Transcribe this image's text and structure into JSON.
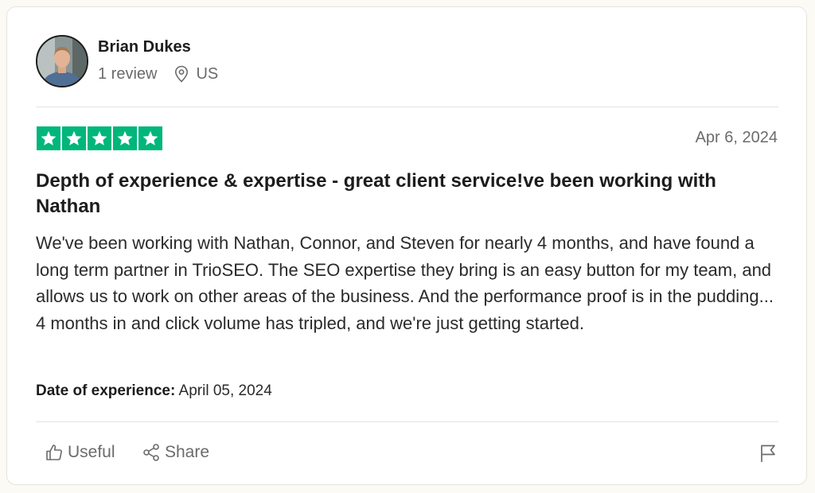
{
  "reviewer": {
    "name": "Brian Dukes",
    "review_count": "1 review",
    "country": "US",
    "avatar_icon": "user-photo"
  },
  "review": {
    "rating": 5,
    "rating_max": 5,
    "star_color": "#00b67a",
    "date": "Apr 6, 2024",
    "title": "Depth of experience & expertise - great client service!ve been working with Nathan",
    "body": "We've been working with Nathan, Connor, and Steven for nearly 4 months, and have found a long term partner in TrioSEO. The SEO expertise they bring is an easy button for my team, and allows us to work on other areas of the business. And the performance proof is in the pudding... 4 months in and click volume has tripled, and we're just getting started.",
    "experience_label": "Date of experience:",
    "experience_date": "April 05, 2024"
  },
  "actions": {
    "useful_label": "Useful",
    "useful_icon": "thumbs-up-icon",
    "share_label": "Share",
    "share_icon": "share-icon",
    "report_icon": "flag-icon"
  }
}
